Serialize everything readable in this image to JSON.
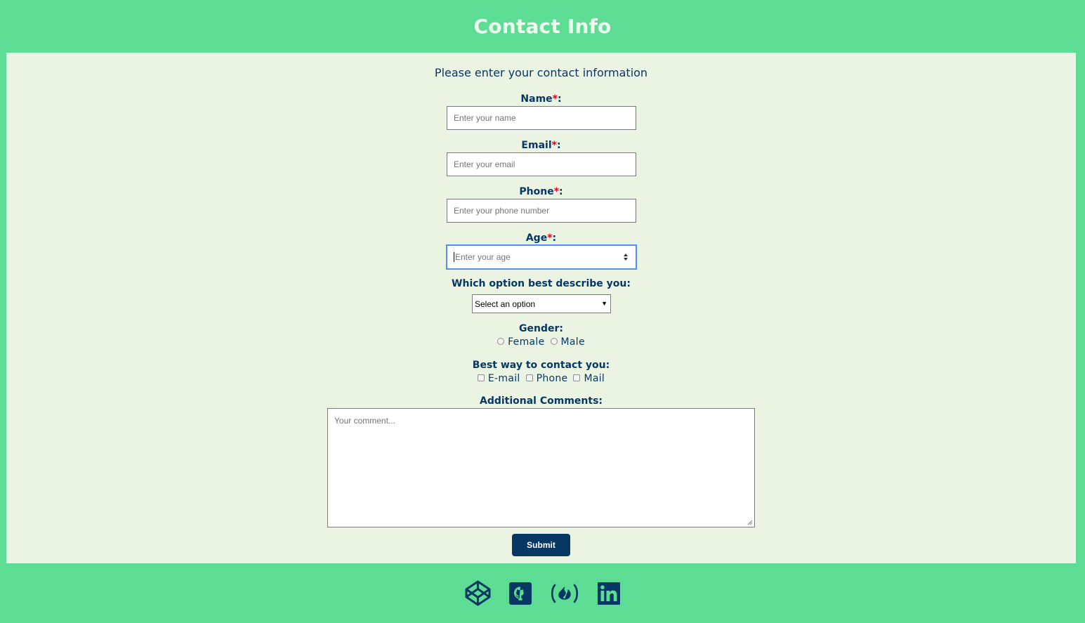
{
  "header": {
    "title": "Contact Info"
  },
  "form": {
    "subtitle": "Please enter your contact information",
    "required_mark": "*",
    "name": {
      "label": "Name",
      "placeholder": "Enter your name"
    },
    "email": {
      "label": "Email",
      "placeholder": "Enter your email"
    },
    "phone": {
      "label": "Phone",
      "placeholder": "Enter your phone number"
    },
    "age": {
      "label": "Age",
      "placeholder": "Enter your age"
    },
    "role": {
      "label": "Which option best describe you:",
      "selected": "Select an option"
    },
    "gender": {
      "label": "Gender:",
      "options": [
        "Female",
        "Male"
      ]
    },
    "contact": {
      "label": "Best way to contact you:",
      "options": [
        "E-mail",
        "Phone",
        "Mail"
      ]
    },
    "comments": {
      "label": "Additional Comments:",
      "placeholder": "Your comment..."
    },
    "submit_label": "Submit"
  },
  "footer": {
    "icons": [
      "codepen-icon",
      "github-icon",
      "freecodecamp-icon",
      "linkedin-icon"
    ],
    "icon_color": "#073763"
  },
  "colors": {
    "background": "#5ddd94",
    "panel": "#ebf4e2",
    "text": "#073763",
    "required": "#e0001a",
    "button": "#073763"
  }
}
